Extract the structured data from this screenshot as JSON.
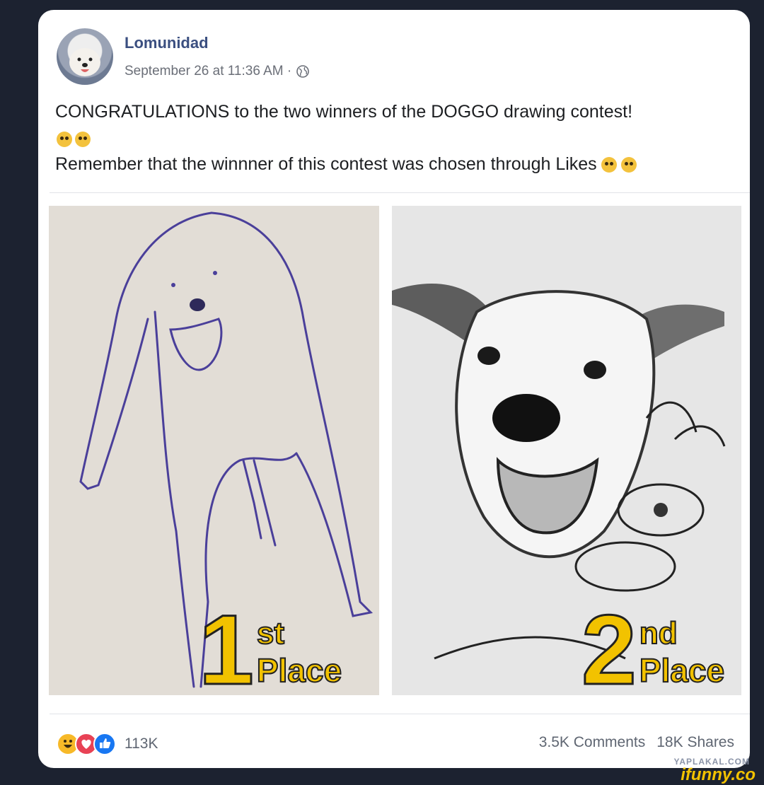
{
  "post": {
    "author": "Lomunidad",
    "timestamp": "September 26 at 11:36 AM ·",
    "privacy_icon": "globe-icon",
    "text_line1": "CONGRATULATIONS to the two winners of the DOGGO drawing contest!",
    "text_line2": "Remember that the winnner of this contest was chosen through Likes"
  },
  "images": [
    {
      "place_number": "1",
      "place_suffix": "st",
      "place_word": "Place"
    },
    {
      "place_number": "2",
      "place_suffix": "nd",
      "place_word": "Place"
    }
  ],
  "footer": {
    "reaction_icons": [
      "haha-icon",
      "love-icon",
      "like-icon"
    ],
    "reaction_count": "113K",
    "comments": "3.5K Comments",
    "shares": "18K Shares"
  },
  "watermarks": {
    "top": "YAPLAKAL.COM",
    "bottom": "ifunny.co"
  },
  "colors": {
    "author_link": "#3b4f80",
    "place_gold": "#f2c200",
    "like_blue": "#1877f2",
    "love_red": "#e84255",
    "haha_yellow": "#f7b928"
  }
}
